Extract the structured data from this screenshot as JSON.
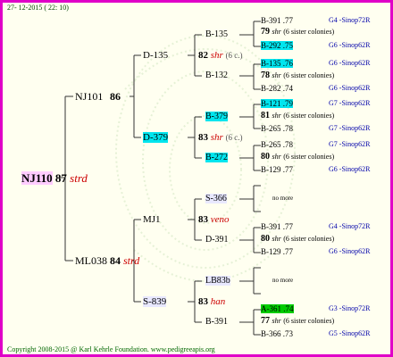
{
  "header": {
    "date": "27- 12-2015 ( 22: 10)"
  },
  "footer": {
    "copyright": "Copyright 2008-2015 @ Karl Kehrle Foundation.   www.pedigreeapis.org"
  },
  "subject": {
    "id": "NJ110",
    "num": "87",
    "strain": "strd"
  },
  "gen1": [
    {
      "id": "NJ101",
      "num": "86",
      "strain": ""
    },
    {
      "id": "ML038",
      "num": "84",
      "strain": "strd"
    }
  ],
  "gen2": [
    {
      "id": "D-135",
      "num": "82",
      "strain": "shr",
      "extra": "(6 c.)"
    },
    {
      "id": "D-379",
      "num": "83",
      "strain": "shr",
      "extra": "(6 c.)"
    },
    {
      "id": "MJ1",
      "num": "83",
      "strain": "veno",
      "extra": ""
    },
    {
      "id": "S-839",
      "num": "83",
      "strain": "han",
      "extra": ""
    }
  ],
  "gen3": [
    {
      "id": "B-135"
    },
    {
      "id": "B-132"
    },
    {
      "id": "B-379"
    },
    {
      "id": "B-272"
    },
    {
      "id": "S-366"
    },
    {
      "id": "D-391"
    },
    {
      "id": "LB83b"
    },
    {
      "id": "B-391"
    }
  ],
  "gen4": [
    {
      "id": "B-391",
      "val": ".77",
      "ped": "G4 -Sinop72R"
    },
    {
      "id": "B-292",
      "val": ".75",
      "ped": "G6 -Sinop62R"
    },
    {
      "id": "B-135",
      "val": ".76",
      "ped": "G6 -Sinop62R"
    },
    {
      "id": "B-282",
      "val": ".74",
      "ped": "G6 -Sinop62R"
    },
    {
      "id": "B-121",
      "val": ".79",
      "ped": "G7 -Sinop62R"
    },
    {
      "id": "B-265",
      "val": ".78",
      "ped": "G7 -Sinop62R"
    },
    {
      "id": "B-265",
      "val": ".78",
      "ped": "G7 -Sinop62R"
    },
    {
      "id": "B-129",
      "val": ".77",
      "ped": "G6 -Sinop62R"
    },
    {
      "id": "B-391",
      "val": ".77",
      "ped": "G4 -Sinop72R"
    },
    {
      "id": "B-129",
      "val": ".77",
      "ped": "G6 -Sinop62R"
    },
    {
      "id": "A-361",
      "val": ".74",
      "ped": "G3 -Sinop72R"
    },
    {
      "id": "B-366",
      "val": ".73",
      "ped": "G5 -Sinop62R"
    }
  ],
  "gen3nums": [
    {
      "num": "79",
      "strain": "shr",
      "extra": "(6 sister colonies)"
    },
    {
      "num": "78",
      "strain": "shr",
      "extra": "(6 sister colonies)"
    },
    {
      "num": "81",
      "strain": "shr",
      "extra": "(6 sister colonies)"
    },
    {
      "num": "80",
      "strain": "shr",
      "extra": "(6 sister colonies)"
    },
    {
      "num": "80",
      "strain": "shr",
      "extra": "(6 sister colonies)"
    },
    {
      "num": "77",
      "strain": "shr",
      "extra": "(6 sister colonies)"
    }
  ],
  "nomore": "no more",
  "colors": {
    "border": "#e000c8",
    "cyan": "#00e5ee",
    "green": "#00cc00",
    "pink": "#ffccff",
    "strain": "#cc0000"
  }
}
